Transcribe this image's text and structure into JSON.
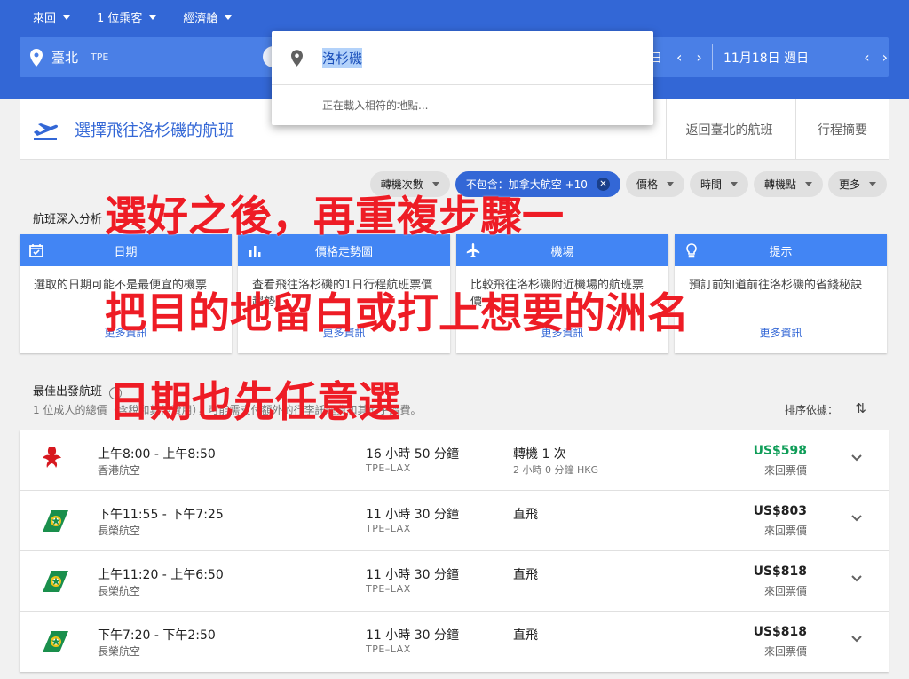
{
  "header": {
    "trip_type": "來回",
    "passengers": "1 位乘客",
    "cabin": "經濟艙",
    "origin_city": "臺北",
    "origin_code": "TPE",
    "depart_date_partial": "日",
    "return_date": "11月18日 週日"
  },
  "autocomplete": {
    "query": "洛杉磯",
    "loading": "正在載入相符的地點..."
  },
  "steps": {
    "current": "選擇飛往洛杉磯的航班",
    "return": "返回臺北的航班",
    "summary": "行程摘要"
  },
  "filters": [
    {
      "label": "轉機次數"
    },
    {
      "label": "不包含：加拿大航空 +10",
      "active": true
    },
    {
      "label": "價格"
    },
    {
      "label": "時間"
    },
    {
      "label": "轉機點"
    },
    {
      "label": "更多"
    }
  ],
  "insights": {
    "title": "航班深入分析",
    "cards": [
      {
        "head": "日期",
        "icon": "calendar-icon",
        "body": "選取的日期可能不是最便宜的機票",
        "more": "更多資訊"
      },
      {
        "head": "價格走勢圖",
        "icon": "chart-icon",
        "body": "查看飛往洛杉磯的1日行程航班票價趨勢",
        "more": "更多資訊"
      },
      {
        "head": "機場",
        "icon": "plane-icon",
        "body": "比較飛往洛杉磯附近機場的航班票價",
        "more": "更多資訊"
      },
      {
        "head": "提示",
        "icon": "lightbulb-icon",
        "body": "預訂前知道前往洛杉磯的省錢秘訣",
        "more": "更多資訊"
      }
    ]
  },
  "results": {
    "title": "最佳出發航班",
    "subtitle": "1 位成人的總價（含稅和其他費用），可能需支付額外的行李託運費和其他手續費。",
    "sort_label": "排序依據：",
    "flights": [
      {
        "times": "上午8:00 - 上午8:50",
        "airline": "香港航空",
        "duration": "16 小時 50 分鐘",
        "route": "TPE–LAX",
        "stops": "轉機 1 次",
        "stop_detail": "2 小時 0 分鐘 HKG",
        "price": "US$598",
        "price_type": "來回票價",
        "logo": "hk",
        "cheapest": true
      },
      {
        "times": "下午11:55 - 下午7:25",
        "airline": "長榮航空",
        "duration": "11 小時 30 分鐘",
        "route": "TPE–LAX",
        "stops": "直飛",
        "stop_detail": "",
        "price": "US$803",
        "price_type": "來回票價",
        "logo": "eva"
      },
      {
        "times": "上午11:20 - 上午6:50",
        "airline": "長榮航空",
        "duration": "11 小時 30 分鐘",
        "route": "TPE–LAX",
        "stops": "直飛",
        "stop_detail": "",
        "price": "US$818",
        "price_type": "來回票價",
        "logo": "eva"
      },
      {
        "times": "下午7:20 - 下午2:50",
        "airline": "長榮航空",
        "duration": "11 小時 30 分鐘",
        "route": "TPE–LAX",
        "stops": "直飛",
        "stop_detail": "",
        "price": "US$818",
        "price_type": "來回票價",
        "logo": "eva"
      }
    ]
  },
  "annotations": {
    "line1": "選好之後，再重複步驟一",
    "line2": "把目的地留白或打上想要的洲名",
    "line3": "日期也先任意選"
  },
  "colors": {
    "header_blue": "#3367d6",
    "accent_blue": "#4285f4",
    "price_green": "#0f9d58",
    "annotation_red": "#ee1c25"
  }
}
